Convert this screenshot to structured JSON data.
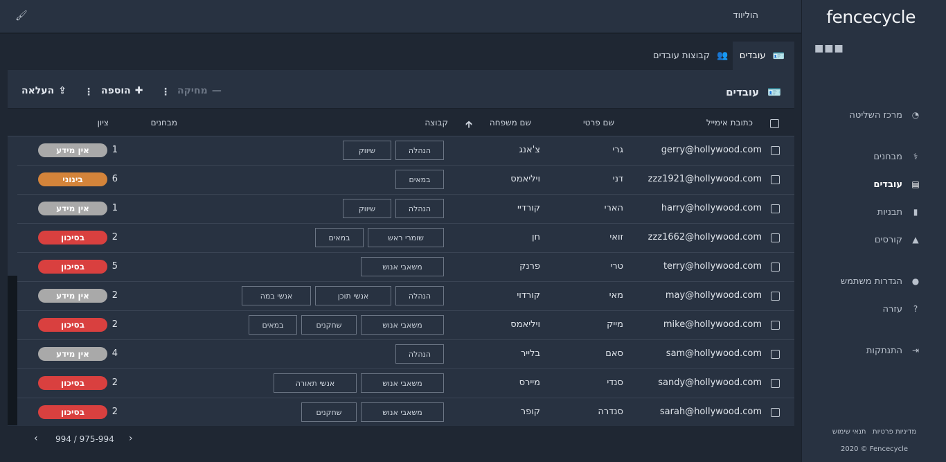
{
  "header": {
    "org_name": "הוליווד",
    "brush_icon": "paint-brush-icon"
  },
  "sidebar": {
    "logo": "fencecycle",
    "more_icon": "more-dots-icon",
    "items": [
      {
        "label": "מרכז השליטה",
        "icon": "dashboard-icon",
        "active": false
      },
      {
        "label": "מבחנים",
        "icon": "stethoscope-icon",
        "active": false
      },
      {
        "label": "עובדים",
        "icon": "id-card-icon",
        "active": true
      },
      {
        "label": "תבניות",
        "icon": "file-icon",
        "active": false
      },
      {
        "label": "קורסים",
        "icon": "graduation-cap-icon",
        "active": false
      },
      {
        "label": "הגדרות משתמש",
        "icon": "user-icon",
        "active": false
      },
      {
        "label": "עזרה",
        "icon": "help-circle-icon",
        "active": false
      },
      {
        "label": "התנתקות",
        "icon": "sign-out-icon",
        "active": false
      }
    ],
    "footer_links": [
      "מדיניות פרטיות",
      "תנאי שימוש"
    ],
    "copyright": "2020 © Fencecycle"
  },
  "tabs": [
    {
      "label": "עובדים",
      "icon": "id-card-icon",
      "active": true
    },
    {
      "label": "קבוצות עובדים",
      "icon": "users-icon",
      "active": false
    }
  ],
  "toolbar": {
    "title": "עובדים",
    "delete_label": "מחיקה",
    "add_label": "הוספה",
    "upload_label": "העלאה"
  },
  "table": {
    "columns": {
      "email": "כתובת אימייל",
      "first_name": "שם פרטי",
      "last_name": "שם משפחה",
      "group": "קבוצה",
      "tests": "מבחנים",
      "score": "ציון"
    },
    "rows": [
      {
        "email": "gerry@hollywood.com",
        "first": "גרי",
        "last": "צ'אנג",
        "groups": [
          "הנהלה",
          "שיווק"
        ],
        "tests": "1",
        "score": "אין מידע",
        "status": "none"
      },
      {
        "email": "zzz1921@hollywood.com",
        "first": "דני",
        "last": "ויליאמס",
        "groups": [
          "במאים"
        ],
        "tests": "6",
        "score": "בינוני",
        "status": "medium"
      },
      {
        "email": "harry@hollywood.com",
        "first": "הארי",
        "last": "קורדיי",
        "groups": [
          "הנהלה",
          "שיווק"
        ],
        "tests": "1",
        "score": "אין מידע",
        "status": "none"
      },
      {
        "email": "zzz1662@hollywood.com",
        "first": "זואי",
        "last": "חן",
        "groups": [
          "שומרי ראש",
          "במאים"
        ],
        "tests": "2",
        "score": "בסיכון",
        "status": "risk"
      },
      {
        "email": "terry@hollywood.com",
        "first": "טרי",
        "last": "פרנק",
        "groups": [
          "משאבי אנוש"
        ],
        "tests": "5",
        "score": "בסיכון",
        "status": "risk"
      },
      {
        "email": "may@hollywood.com",
        "first": "מאי",
        "last": "קורדוי",
        "groups": [
          "הנהלה",
          "אנשי תוכן",
          "אנשי במה"
        ],
        "tests": "2",
        "score": "אין מידע",
        "status": "none"
      },
      {
        "email": "mike@hollywood.com",
        "first": "מייק",
        "last": "ויליאמס",
        "groups": [
          "משאבי אנוש",
          "שחקנים",
          "במאים"
        ],
        "tests": "2",
        "score": "בסיכון",
        "status": "risk"
      },
      {
        "email": "sam@hollywood.com",
        "first": "סאם",
        "last": "בלייר",
        "groups": [
          "הנהלה"
        ],
        "tests": "4",
        "score": "אין מידע",
        "status": "none"
      },
      {
        "email": "sandy@hollywood.com",
        "first": "סנדי",
        "last": "מיירס",
        "groups": [
          "משאבי אנוש",
          "אנשי תאורה"
        ],
        "tests": "2",
        "score": "בסיכון",
        "status": "risk"
      },
      {
        "email": "sarah@hollywood.com",
        "first": "סנדרה",
        "last": "קופר",
        "groups": [
          "משאבי אנוש",
          "שחקנים"
        ],
        "tests": "2",
        "score": "בסיכון",
        "status": "risk"
      }
    ]
  },
  "pagination": {
    "text": "994 / 975-994"
  },
  "colors": {
    "risk": "#d9403f",
    "medium": "#d4843a",
    "none": "#a9a9a9"
  }
}
